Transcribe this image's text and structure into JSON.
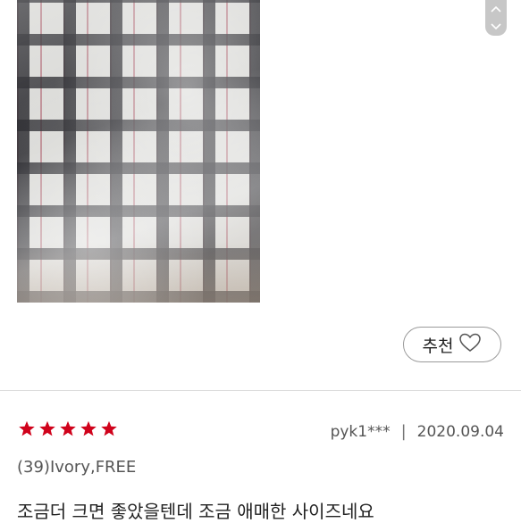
{
  "review": {
    "recommend_label": "추천",
    "author": "pyk1***",
    "separator": "|",
    "date": "2020.09.04",
    "option": "(39)Ivory,FREE",
    "text": "조금더 크면 좋았을텐데 조금 애매한 사이즈네요",
    "rating": 5,
    "max_rating": 5
  },
  "icons": {
    "scroll_up": "chevron-up-icon",
    "scroll_down": "chevron-down-icon",
    "recommend": "heart-icon",
    "star": "star-icon"
  },
  "colors": {
    "star": "#d0021b",
    "border": "#9a9a9a",
    "scroll_control": "#c7c7c7"
  }
}
